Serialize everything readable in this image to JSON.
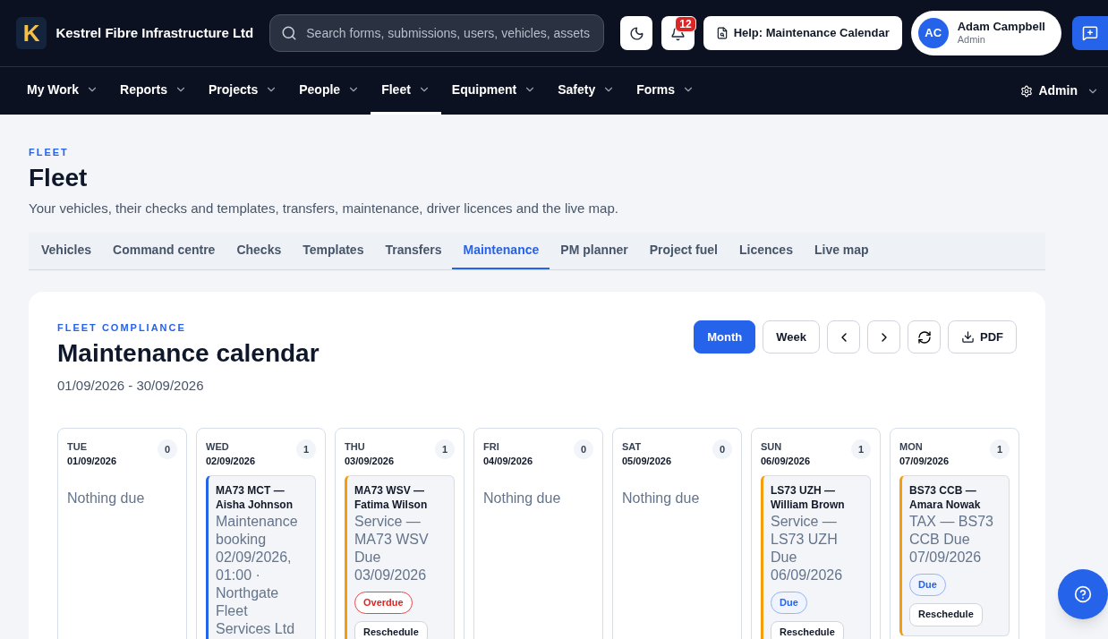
{
  "brand": {
    "logo_letter": "K",
    "name": "Kestrel Fibre Infrastructure Ltd"
  },
  "search": {
    "placeholder": "Search forms, submissions, users, vehicles, assets"
  },
  "notifications": {
    "count": "12"
  },
  "help_button": "Help: Maintenance Calendar",
  "user": {
    "initials": "AC",
    "name": "Adam Campbell",
    "role": "Admin"
  },
  "nav": [
    {
      "label": "My Work",
      "selected": false
    },
    {
      "label": "Reports",
      "selected": false
    },
    {
      "label": "Projects",
      "selected": false
    },
    {
      "label": "People",
      "selected": false
    },
    {
      "label": "Fleet",
      "selected": true
    },
    {
      "label": "Equipment",
      "selected": false
    },
    {
      "label": "Safety",
      "selected": false
    },
    {
      "label": "Forms",
      "selected": false
    }
  ],
  "admin_menu": "Admin",
  "page": {
    "eyebrow": "FLEET",
    "title": "Fleet",
    "description": "Your vehicles, their checks and templates, transfers, maintenance, driver licences and the live map."
  },
  "tabs": [
    {
      "label": "Vehicles",
      "selected": false
    },
    {
      "label": "Command centre",
      "selected": false
    },
    {
      "label": "Checks",
      "selected": false
    },
    {
      "label": "Templates",
      "selected": false
    },
    {
      "label": "Transfers",
      "selected": false
    },
    {
      "label": "Maintenance",
      "selected": true
    },
    {
      "label": "PM planner",
      "selected": false
    },
    {
      "label": "Project fuel",
      "selected": false
    },
    {
      "label": "Licences",
      "selected": false
    },
    {
      "label": "Live map",
      "selected": false
    }
  ],
  "calendar": {
    "eyebrow": "FLEET COMPLIANCE",
    "title": "Maintenance calendar",
    "range": "01/09/2026 - 30/09/2026",
    "views": [
      {
        "label": "Month",
        "selected": true
      },
      {
        "label": "Week",
        "selected": false
      }
    ],
    "pdf_button": "PDF",
    "days": [
      {
        "weekday": "TUE",
        "date": "01/09/2026",
        "count": "0",
        "empty_text": "Nothing due"
      },
      {
        "weekday": "WED",
        "date": "02/09/2026",
        "count": "1",
        "events": [
          {
            "title": "MA73 MCT — Aisha Johnson",
            "detail": "Maintenance booking 02/09/2026, 01:00 · Northgate Fleet Services Ltd",
            "color": "#2563eb"
          }
        ]
      },
      {
        "weekday": "THU",
        "date": "03/09/2026",
        "count": "1",
        "events": [
          {
            "title": "MA73 WSV — Fatima Wilson",
            "detail": "Service — MA73 WSV Due 03/09/2026",
            "color": "#f59e0b",
            "status": {
              "kind": "overdue",
              "label": "Overdue"
            },
            "action": "Reschedule"
          }
        ]
      },
      {
        "weekday": "FRI",
        "date": "04/09/2026",
        "count": "0",
        "empty_text": "Nothing due"
      },
      {
        "weekday": "SAT",
        "date": "05/09/2026",
        "count": "0",
        "empty_text": "Nothing due"
      },
      {
        "weekday": "SUN",
        "date": "06/09/2026",
        "count": "1",
        "events": [
          {
            "title": "LS73 UZH — William Brown",
            "detail": "Service — LS73 UZH Due 06/09/2026",
            "color": "#f59e0b",
            "status": {
              "kind": "due",
              "label": "Due"
            },
            "action": "Reschedule"
          }
        ]
      },
      {
        "weekday": "MON",
        "date": "07/09/2026",
        "count": "1",
        "events": [
          {
            "title": "BS73 CCB — Amara Nowak",
            "detail": "TAX — BS73 CCB Due 07/09/2026",
            "color": "#f59e0b",
            "status": {
              "kind": "due",
              "label": "Due"
            },
            "action": "Reschedule"
          }
        ]
      }
    ]
  }
}
